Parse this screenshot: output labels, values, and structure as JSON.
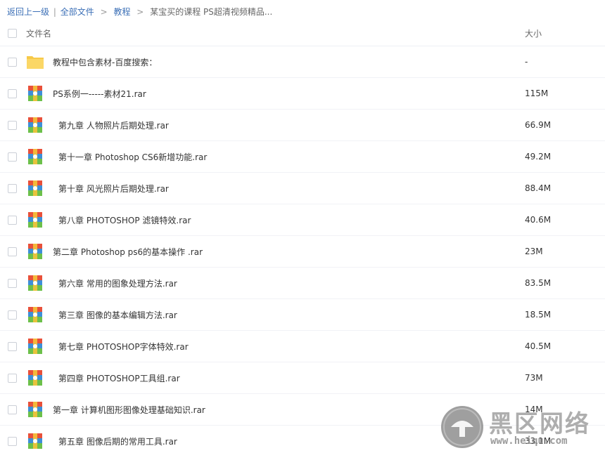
{
  "breadcrumb": {
    "back": "返回上一级",
    "divider": "|",
    "all_files": "全部文件",
    "sep": ">",
    "level1": "教程",
    "current": "某宝买的课程 PS超清视频精品..."
  },
  "header": {
    "name_col": "文件名",
    "size_col": "大小"
  },
  "files": [
    {
      "name": "教程中包含素材-百度搜索：",
      "size": "-",
      "type": "folder",
      "indent": false
    },
    {
      "name": "PS系例一-----素材21.rar",
      "size": "115M",
      "type": "rar",
      "indent": false
    },
    {
      "name": "第九章 人物照片后期处理.rar",
      "size": "66.9M",
      "type": "rar",
      "indent": true
    },
    {
      "name": "第十一章 Photoshop CS6新增功能.rar",
      "size": "49.2M",
      "type": "rar",
      "indent": true
    },
    {
      "name": "第十章 风光照片后期处理.rar",
      "size": "88.4M",
      "type": "rar",
      "indent": true
    },
    {
      "name": "第八章 PHOTOSHOP 滤镜特效.rar",
      "size": "40.6M",
      "type": "rar",
      "indent": true
    },
    {
      "name": "第二章 Photoshop ps6的基本操作 .rar",
      "size": "23M",
      "type": "rar",
      "indent": false
    },
    {
      "name": "第六章 常用的图象处理方法.rar",
      "size": "83.5M",
      "type": "rar",
      "indent": true
    },
    {
      "name": "第三章 图像的基本编辑方法.rar",
      "size": "18.5M",
      "type": "rar",
      "indent": true
    },
    {
      "name": "第七章 PHOTOSHOP字体特效.rar",
      "size": "40.5M",
      "type": "rar",
      "indent": true
    },
    {
      "name": "第四章 PHOTOSHOP工具组.rar",
      "size": "73M",
      "type": "rar",
      "indent": true
    },
    {
      "name": "第一章 计算机图形图像处理基础知识.rar",
      "size": "14M",
      "type": "rar",
      "indent": false
    },
    {
      "name": "第五章 图像后期的常用工具.rar",
      "size": "33.1M",
      "type": "rar",
      "indent": true
    }
  ],
  "watermark": {
    "title": "黑区网络",
    "url": "www.heiqu.com"
  },
  "colors": {
    "link": "#3b6fb6",
    "folder": "#f7c948",
    "rar_red": "#e8503a",
    "rar_blue": "#3d8fd8",
    "rar_green": "#6cc04a",
    "rar_yellow": "#f5c33b"
  }
}
